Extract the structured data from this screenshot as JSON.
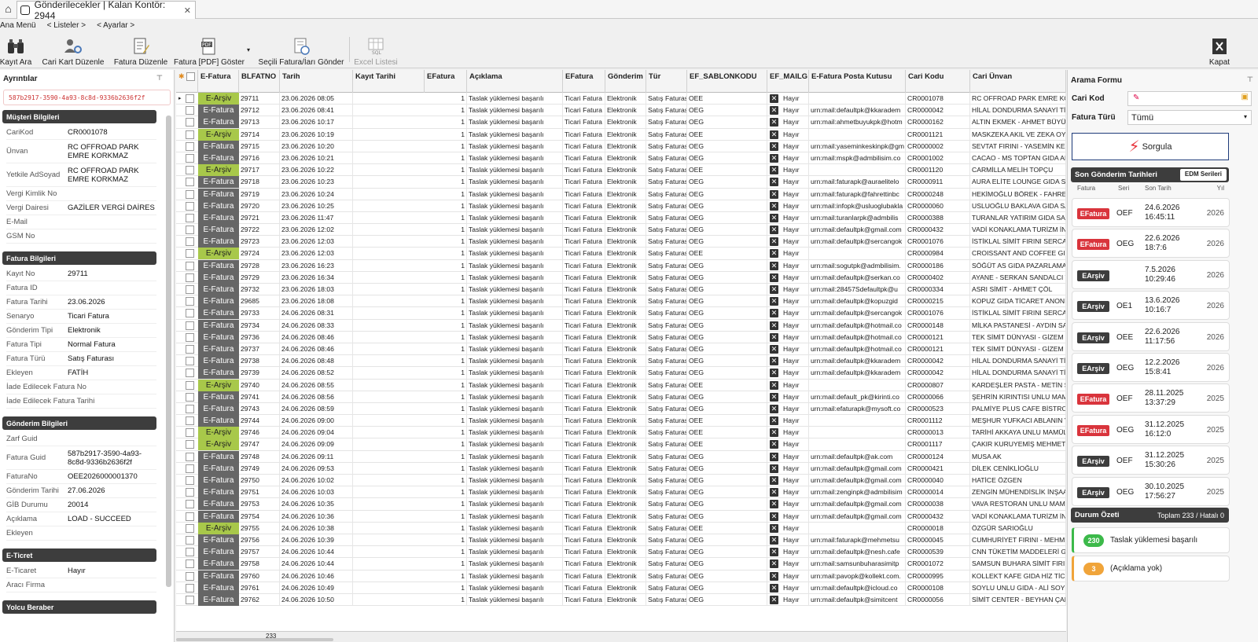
{
  "tab": {
    "title": "Gönderilecekler  |  Kalan Kontör: 2944"
  },
  "menu": [
    "Ana Menü",
    "< Listeler >",
    "< Ayarlar >"
  ],
  "toolbar": {
    "kayit_ara": "Kayıt Ara",
    "cari_kart": "Cari Kart Düzenle",
    "fatura_duzenle": "Fatura Düzenle",
    "pdf_goster": "Fatura [PDF] Göster",
    "secili_gonder": "Seçili Fatura/İarı Gönder",
    "excel": "Excel Listesi",
    "kapat": "Kapat"
  },
  "left": {
    "title": "Ayrıntılar",
    "guid": "587b2917-3590-4a93-8c8d-9336b2636f2f",
    "sections": [
      {
        "title": "Müşteri Bilgileri",
        "rows": [
          [
            "CariKod",
            "CR0001078"
          ],
          [
            "Ünvan",
            "RC OFFROAD PARK EMRE KORKMAZ"
          ],
          [
            "Yetkile AdSoyad",
            "RC OFFROAD PARK EMRE KORKMAZ"
          ],
          [
            "Vergi Kimlik No",
            ""
          ],
          [
            "Vergi Dairesi",
            "GAZİLER VERGİ DAİRES"
          ],
          [
            "E-Mail",
            ""
          ],
          [
            "GSM No",
            ""
          ]
        ]
      },
      {
        "title": "Fatura Bilgileri",
        "rows": [
          [
            "Kayıt No",
            "29711"
          ],
          [
            "Fatura ID",
            ""
          ],
          [
            "Fatura Tarihi",
            "23.06.2026"
          ],
          [
            "Senaryo",
            "Ticari Fatura"
          ],
          [
            "Gönderim Tipi",
            "Elektronik"
          ],
          [
            "Fatura Tipi",
            "Normal Fatura"
          ],
          [
            "Fatura Türü",
            "Satış Faturası"
          ],
          [
            "Ekleyen",
            "FATİH"
          ],
          [
            "İade Edilecek Fatura No",
            ""
          ],
          [
            "İade Edilecek Fatura Tarihi",
            ""
          ]
        ]
      },
      {
        "title": "Gönderim Bilgileri",
        "rows": [
          [
            "Zarf Guid",
            ""
          ],
          [
            "Fatura Guid",
            "587b2917-3590-4a93-8c8d-9336b2636f2f"
          ],
          [
            "FaturaNo",
            "OEE2026000001370"
          ],
          [
            "Gönderim Tarihi",
            "27.06.2026"
          ],
          [
            "GİB Durumu",
            "20014"
          ],
          [
            "Açıklama",
            "LOAD - SUCCEED"
          ],
          [
            "Ekleyen",
            ""
          ]
        ]
      },
      {
        "title": "E-Ticret",
        "rows": [
          [
            "E-Ticaret",
            "Hayır"
          ],
          [
            "Aracı Firma",
            ""
          ]
        ]
      },
      {
        "title": "Yolcu Beraber",
        "rows": []
      }
    ]
  },
  "grid": {
    "columns": [
      "E-Fatura",
      "BLFATNO",
      "Tarih",
      "Kayıt Tarihi",
      "EFatura",
      "Açıklama",
      "EFatura",
      "Gönderim",
      "Tür",
      "EF_SABLONKODU",
      "EF_MAILG",
      "E-Fatura Posta Kutusu",
      "Cari Kodu",
      "Cari Ünvan"
    ],
    "footer_count": "233",
    "rows": [
      [
        "E-Arşiv",
        "29711",
        "23.06.2026 08:05",
        "1",
        "Taslak yüklemesi başarılı",
        "Ticari Fatura",
        "Elektronik",
        "Satış Faturası",
        "OEE",
        "Hayır",
        "",
        "CR0001078",
        "RC OFFROAD PARK EMRE KORKMAZ"
      ],
      [
        "E-Fatura",
        "29712",
        "23.06.2026 08:41",
        "1",
        "Taslak yüklemesi başarılı",
        "Ticari Fatura",
        "Elektronik",
        "Satış Faturası",
        "OEG",
        "Hayır",
        "urn:mail:defaultpk@kkaradem",
        "CR0000042",
        "HİLAL DONDURMA SANAYİ TİCARET"
      ],
      [
        "E-Fatura",
        "29713",
        "23.06.2026 10:17",
        "1",
        "Taslak yüklemesi başarılı",
        "Ticari Fatura",
        "Elektronik",
        "Satış Faturası",
        "OEG",
        "Hayır",
        "urn:mail:ahmetbuyukpk@hotm",
        "CR0000162",
        "ALTIN EKMEK - AHMET BÜYÜK"
      ],
      [
        "E-Arşiv",
        "29714",
        "23.06.2026 10:19",
        "1",
        "Taslak yüklemesi başarılı",
        "Ticari Fatura",
        "Elektronik",
        "Satış Faturası",
        "OEE",
        "Hayır",
        "",
        "CR0001121",
        "MASKZEKA AKIL VE ZEKA OYUNLARI"
      ],
      [
        "E-Fatura",
        "29715",
        "23.06.2026 10:20",
        "1",
        "Taslak yüklemesi başarılı",
        "Ticari Fatura",
        "Elektronik",
        "Satış Faturası",
        "OEG",
        "Hayır",
        "urn:mail:yaseminkeskinpk@gm",
        "CR0000002",
        "SEVTAT FIRINI - YASEMİN KESKİN"
      ],
      [
        "E-Fatura",
        "29716",
        "23.06.2026 10:21",
        "1",
        "Taslak yüklemesi başarılı",
        "Ticari Fatura",
        "Elektronik",
        "Satış Faturası",
        "OEG",
        "Hayır",
        "urn:mail:mspk@admbilisim.co",
        "CR0001002",
        "CACAO - MS TOPTAN GIDA ARAN"
      ],
      [
        "E-Arşiv",
        "29717",
        "23.06.2026 10:22",
        "1",
        "Taslak yüklemesi başarılı",
        "Ticari Fatura",
        "Elektronik",
        "Satış Faturası",
        "OEE",
        "Hayır",
        "",
        "CR0001120",
        "CARMİLLA MELİH TOPÇU"
      ],
      [
        "E-Fatura",
        "29718",
        "23.06.2026 10:23",
        "1",
        "Taslak yüklemesi başarılı",
        "Ticari Fatura",
        "Elektronik",
        "Satış Faturası",
        "OEG",
        "Hayır",
        "urn:mail:faturapk@auraelitelo",
        "CR0000911",
        "AURA ELİTE LOUNGE GIDA SANAYİ"
      ],
      [
        "E-Fatura",
        "29719",
        "23.06.2026 10:24",
        "1",
        "Taslak yüklemesi başarılı",
        "Ticari Fatura",
        "Elektronik",
        "Satış Faturası",
        "OEG",
        "Hayır",
        "urn:mail:faturapk@fahrettinbc",
        "CR0000248",
        "HEKİMOĞLU BÖREK - FAHRETTİN"
      ],
      [
        "E-Fatura",
        "29720",
        "23.06.2026 10:25",
        "1",
        "Taslak yüklemesi başarılı",
        "Ticari Fatura",
        "Elektronik",
        "Satış Faturası",
        "OEG",
        "Hayır",
        "urn:mail:infopk@usluoglubakla",
        "CR0000060",
        "USLUOĞLU BAKLAVA GIDA SANAYİ"
      ],
      [
        "E-Fatura",
        "29721",
        "23.06.2026 11:47",
        "1",
        "Taslak yüklemesi başarılı",
        "Ticari Fatura",
        "Elektronik",
        "Satış Faturası",
        "OEG",
        "Hayır",
        "urn:mail:turanlarpk@admbilis",
        "CR0000388",
        "TURANLAR YATIRIM GIDA SANAYİ"
      ],
      [
        "E-Fatura",
        "29722",
        "23.06.2026 12:02",
        "1",
        "Taslak yüklemesi başarılı",
        "Ticari Fatura",
        "Elektronik",
        "Satış Faturası",
        "OEG",
        "Hayır",
        "urn:mail:defaultpk@gmail.com",
        "CR0000432",
        "VADİ KONAKLAMA TURİZM İNŞAAT"
      ],
      [
        "E-Fatura",
        "29723",
        "23.06.2026 12:03",
        "1",
        "Taslak yüklemesi başarılı",
        "Ticari Fatura",
        "Elektronik",
        "Satış Faturası",
        "OEG",
        "Hayır",
        "urn:mail:defaultpk@sercangok",
        "CR0001076",
        "İSTİKLAL SİMİT FIRINI SERCAN GÖK"
      ],
      [
        "E-Arşiv",
        "29724",
        "23.06.2026 12:03",
        "1",
        "Taslak yüklemesi başarılı",
        "Ticari Fatura",
        "Elektronik",
        "Satış Faturası",
        "OEE",
        "Hayır",
        "",
        "CR0000984",
        "CROISSANT AND COFFEE GIDA SAN"
      ],
      [
        "E-Fatura",
        "29728",
        "23.06.2026 16:23",
        "1",
        "Taslak yüklemesi başarılı",
        "Ticari Fatura",
        "Elektronik",
        "Satış Faturası",
        "OEG",
        "Hayır",
        "urn:mail:sogutpk@admbilisim.",
        "CR0000186",
        "SÖĞÜT AS GIDA PAZARLAMA SANAYİ"
      ],
      [
        "E-Fatura",
        "29729",
        "23.06.2026 16:34",
        "1",
        "Taslak yüklemesi başarılı",
        "Ticari Fatura",
        "Elektronik",
        "Satış Faturası",
        "OEG",
        "Hayır",
        "urn:mail:defaultpk@serkan.co",
        "CR0000402",
        "AYANE - SERKAN SANDALCI VE GÜL"
      ],
      [
        "E-Fatura",
        "29732",
        "23.06.2026 18:03",
        "1",
        "Taslak yüklemesi başarılı",
        "Ticari Fatura",
        "Elektronik",
        "Satış Faturası",
        "OEG",
        "Hayır",
        "urn:mail:28457Sdefaultpk@u",
        "CR0000334",
        "ASRI SİMİT - AHMET ÇÖL"
      ],
      [
        "E-Fatura",
        "29685",
        "23.06.2026 18:08",
        "1",
        "Taslak yüklemesi başarılı",
        "Ticari Fatura",
        "Elektronik",
        "Satış Faturası",
        "OEG",
        "Hayır",
        "urn:mail:defaultpk@kopuzgid",
        "CR0000215",
        "KOPUZ GIDA TİCARET ANONİM ŞİRKETİ"
      ],
      [
        "E-Fatura",
        "29733",
        "24.06.2026 08:31",
        "1",
        "Taslak yüklemesi başarılı",
        "Ticari Fatura",
        "Elektronik",
        "Satış Faturası",
        "OEG",
        "Hayır",
        "urn:mail:defaultpk@sercangok",
        "CR0001076",
        "İSTİKLAL SİMİT FIRINI SERCAN GÖK"
      ],
      [
        "E-Fatura",
        "29734",
        "24.06.2026 08:33",
        "1",
        "Taslak yüklemesi başarılı",
        "Ticari Fatura",
        "Elektronik",
        "Satış Faturası",
        "OEG",
        "Hayır",
        "urn:mail:defaultpk@hotmail.co",
        "CR0000148",
        "MİLKA PASTANESİ - AYDIN SARIOĞLU"
      ],
      [
        "E-Fatura",
        "29736",
        "24.06.2026 08:46",
        "1",
        "Taslak yüklemesi başarılı",
        "Ticari Fatura",
        "Elektronik",
        "Satış Faturası",
        "OEG",
        "Hayır",
        "urn:mail:defaultpk@hotmail.co",
        "CR0000121",
        "TEK SİMİT DÜNYASI - GİZEM KAN"
      ],
      [
        "E-Fatura",
        "29737",
        "24.06.2026 08:46",
        "1",
        "Taslak yüklemesi başarılı",
        "Ticari Fatura",
        "Elektronik",
        "Satış Faturası",
        "OEG",
        "Hayır",
        "urn:mail:defaultpk@hotmail.co",
        "CR0000121",
        "TEK SİMİT DÜNYASI - GİZEM KAN"
      ],
      [
        "E-Fatura",
        "29738",
        "24.06.2026 08:48",
        "1",
        "Taslak yüklemesi başarılı",
        "Ticari Fatura",
        "Elektronik",
        "Satış Faturası",
        "OEG",
        "Hayır",
        "urn:mail:defaultpk@kkaradem",
        "CR0000042",
        "HİLAL DONDURMA SANAYİ TİCARET"
      ],
      [
        "E-Fatura",
        "29739",
        "24.06.2026 08:52",
        "1",
        "Taslak yüklemesi başarılı",
        "Ticari Fatura",
        "Elektronik",
        "Satış Faturası",
        "OEG",
        "Hayır",
        "urn:mail:defaultpk@kkaradem",
        "CR0000042",
        "HİLAL DONDURMA SANAYİ TİCARET"
      ],
      [
        "E-Arşiv",
        "29740",
        "24.06.2026 08:55",
        "1",
        "Taslak yüklemesi başarılı",
        "Ticari Fatura",
        "Elektronik",
        "Satış Faturası",
        "OEE",
        "Hayır",
        "",
        "CR0000807",
        "KARDEŞLER PASTA - METİN SARI"
      ],
      [
        "E-Fatura",
        "29741",
        "24.06.2026 08:56",
        "1",
        "Taslak yüklemesi başarılı",
        "Ticari Fatura",
        "Elektronik",
        "Satış Faturası",
        "OEG",
        "Hayır",
        "urn:mail:default_pk@kirinti.co",
        "CR0000066",
        "ŞEHRİN KIRINTISI UNLU MAMULLERİ"
      ],
      [
        "E-Fatura",
        "29743",
        "24.06.2026 08:59",
        "1",
        "Taslak yüklemesi başarılı",
        "Ticari Fatura",
        "Elektronik",
        "Satış Faturası",
        "OEG",
        "Hayır",
        "urn:mail:efaturapk@mysoft.co",
        "CR0000523",
        "PALMİYE PLUS CAFE BİSTRO YUNUS"
      ],
      [
        "E-Fatura",
        "29744",
        "24.06.2026 09:00",
        "1",
        "Taslak yüklemesi başarılı",
        "Ticari Fatura",
        "Elektronik",
        "Satış Faturası",
        "OEE",
        "Hayır",
        "",
        "CR0001112",
        "MEŞHUR YUFKACI ABLANIN YERİ"
      ],
      [
        "E-Arşiv",
        "29746",
        "24.06.2026 09:04",
        "1",
        "Taslak yüklemesi başarılı",
        "Ticari Fatura",
        "Elektronik",
        "Satış Faturası",
        "OEE",
        "Hayır",
        "",
        "CR0000013",
        "TARİHİ AKKAYA UNLU MAMÜLLERİ"
      ],
      [
        "E-Arşiv",
        "29747",
        "24.06.2026 09:09",
        "1",
        "Taslak yüklemesi başarılı",
        "Ticari Fatura",
        "Elektronik",
        "Satış Faturası",
        "OEE",
        "Hayır",
        "",
        "CR0001117",
        "ÇAKIR KURUYEMİŞ MEHMET ŞEFİK"
      ],
      [
        "E-Fatura",
        "29748",
        "24.06.2026 09:11",
        "1",
        "Taslak yüklemesi başarılı",
        "Ticari Fatura",
        "Elektronik",
        "Satış Faturası",
        "OEG",
        "Hayır",
        "urn:mail:defaultpk@ak.com",
        "CR0000124",
        "MUSA AK"
      ],
      [
        "E-Fatura",
        "29749",
        "24.06.2026 09:53",
        "1",
        "Taslak yüklemesi başarılı",
        "Ticari Fatura",
        "Elektronik",
        "Satış Faturası",
        "OEG",
        "Hayır",
        "urn:mail:defaultpk@gmail.com",
        "CR0000421",
        "DİLEK CENİKLİOĞLU"
      ],
      [
        "E-Fatura",
        "29750",
        "24.06.2026 10:02",
        "1",
        "Taslak yüklemesi başarılı",
        "Ticari Fatura",
        "Elektronik",
        "Satış Faturası",
        "OEG",
        "Hayır",
        "urn:mail:defaultpk@gmail.com",
        "CR0000040",
        "HATİCE ÖZGEN"
      ],
      [
        "E-Fatura",
        "29751",
        "24.06.2026 10:03",
        "1",
        "Taslak yüklemesi başarılı",
        "Ticari Fatura",
        "Elektronik",
        "Satış Faturası",
        "OEG",
        "Hayır",
        "urn:mail:zenginpk@admbilisim",
        "CR0000014",
        "ZENGİN MÜHENDİSLİK İNŞAAT MAKİNA"
      ],
      [
        "E-Fatura",
        "29753",
        "24.06.2026 10:35",
        "1",
        "Taslak yüklemesi başarılı",
        "Ticari Fatura",
        "Elektronik",
        "Satış Faturası",
        "OEG",
        "Hayır",
        "urn:mail:defaultpk@gmail.com",
        "CR0000038",
        "VAVA RESTORAN UNLU MAMULLERİ"
      ],
      [
        "E-Fatura",
        "29754",
        "24.06.2026 10:36",
        "1",
        "Taslak yüklemesi başarılı",
        "Ticari Fatura",
        "Elektronik",
        "Satış Faturası",
        "OEG",
        "Hayır",
        "urn:mail:defaultpk@gmail.com",
        "CR0000432",
        "VADİ KONAKLAMA TURİZM İNŞAAT"
      ],
      [
        "E-Arşiv",
        "29755",
        "24.06.2026 10:38",
        "1",
        "Taslak yüklemesi başarılı",
        "Ticari Fatura",
        "Elektronik",
        "Satış Faturası",
        "OEE",
        "Hayır",
        "",
        "CR0000018",
        "ÖZGÜR SARIOĞLU"
      ],
      [
        "E-Fatura",
        "29756",
        "24.06.2026 10:39",
        "1",
        "Taslak yüklemesi başarılı",
        "Ticari Fatura",
        "Elektronik",
        "Satış Faturası",
        "OEG",
        "Hayır",
        "urn:mail:faturapk@mehmetsu",
        "CR0000045",
        "CUMHURİYET FIRINI - MEHMET SU"
      ],
      [
        "E-Fatura",
        "29757",
        "24.06.2026 10:44",
        "1",
        "Taslak yüklemesi başarılı",
        "Ticari Fatura",
        "Elektronik",
        "Satış Faturası",
        "OEG",
        "Hayır",
        "urn:mail:defaultpk@nesh.cafe",
        "CR0000539",
        "CNN TÜKETİM MADDELERİ GIDA"
      ],
      [
        "E-Fatura",
        "29758",
        "24.06.2026 10:44",
        "1",
        "Taslak yüklemesi başarılı",
        "Ticari Fatura",
        "Elektronik",
        "Satış Faturası",
        "OEG",
        "Hayır",
        "urn:mail:samsunbuharasimitp",
        "CR0001072",
        "SAMSUN BUHARA SİMİT FIRIN GIDA"
      ],
      [
        "E-Fatura",
        "29760",
        "24.06.2026 10:46",
        "1",
        "Taslak yüklemesi başarılı",
        "Ticari Fatura",
        "Elektronik",
        "Satış Faturası",
        "OEG",
        "Hayır",
        "urn:mail:pavopk@kollekt.com.",
        "CR0000995",
        "KOLLEKT KAFE GIDA HİZ TİC SAN"
      ],
      [
        "E-Fatura",
        "29761",
        "24.06.2026 10:49",
        "1",
        "Taslak yüklemesi başarılı",
        "Ticari Fatura",
        "Elektronik",
        "Satış Faturası",
        "OEG",
        "Hayır",
        "urn:mail:defaultpk@icloud.co",
        "CR0000108",
        "SOYLU UNLU GIDA - ALİ SOYLU"
      ],
      [
        "E-Fatura",
        "29762",
        "24.06.2026 10:50",
        "1",
        "Taslak yüklemesi başarılı",
        "Ticari Fatura",
        "Elektronik",
        "Satış Faturası",
        "OEG",
        "Hayır",
        "urn:mail:defaultpk@simitcent",
        "CR0000056",
        "SİMİT CENTER - BEYHAN ÇAKIR VE"
      ]
    ]
  },
  "right": {
    "title": "Arama Formu",
    "cari_kod_label": "Cari Kod",
    "fatura_turu_label": "Fatura Türü",
    "fatura_turu_value": "Tümü",
    "sorgula": "Sorgula",
    "son_title": "Son Gönderim Tarihleri",
    "edm_btn": "EDM Serileri",
    "cols": [
      "Fatura",
      "Seri",
      "Son Tarih",
      "Yıl"
    ],
    "cards": [
      [
        "EFatura",
        "OEF",
        "24.6.2026",
        "16:45:11",
        "2026",
        "#d9343c"
      ],
      [
        "EFatura",
        "OEG",
        "22.6.2026",
        "18:7:6",
        "2026",
        "#d9343c"
      ],
      [
        "EArşiv",
        "",
        "7.5.2026",
        "10:29:46",
        "2026",
        "#3d3d3d"
      ],
      [
        "EArşiv",
        "OE1",
        "13.6.2026",
        "10:16:7",
        "2026",
        "#3d3d3d"
      ],
      [
        "EArşiv",
        "OEE",
        "22.6.2026",
        "11:17:56",
        "2026",
        "#3d3d3d"
      ],
      [
        "EArşiv",
        "OEG",
        "12.2.2026",
        "15:8:41",
        "2026",
        "#3d3d3d"
      ],
      [
        "EFatura",
        "OEF",
        "28.11.2025",
        "13:37:29",
        "2025",
        "#d9343c"
      ],
      [
        "EFatura",
        "OEG",
        "31.12.2025",
        "16:12:0",
        "2025",
        "#d9343c"
      ],
      [
        "EArşiv",
        "OEF",
        "31.12.2025",
        "15:30:26",
        "2025",
        "#3d3d3d"
      ],
      [
        "EArşiv",
        "OEG",
        "30.10.2025",
        "17:56:27",
        "2025",
        "#3d3d3d"
      ]
    ],
    "durum_title": "Durum Özeti",
    "durum_total": "Toplam 233 / Hatalı 0",
    "summary": [
      [
        "230",
        "Taslak yüklemesi başarılı",
        "#3cb94a"
      ],
      [
        "3",
        "(Açıklama yok)",
        "#f0a43a"
      ]
    ]
  }
}
